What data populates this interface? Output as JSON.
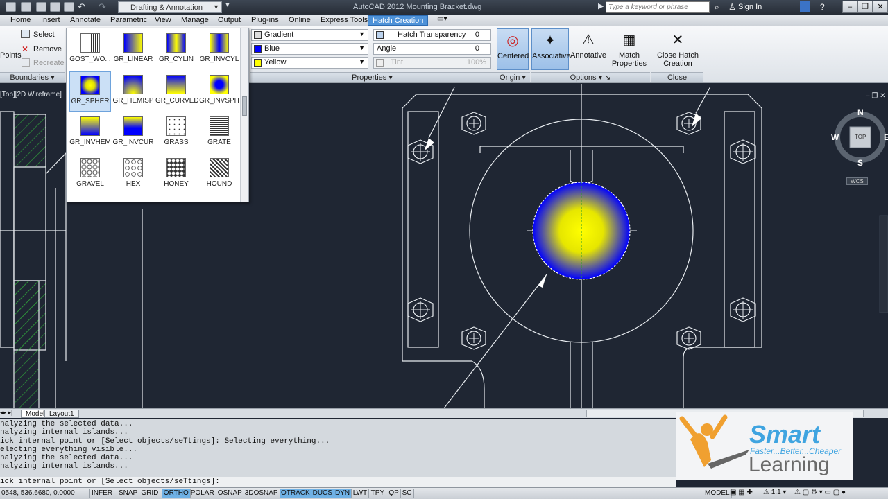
{
  "title_bar": {
    "workspace": "Drafting & Annotation",
    "app_title": "AutoCAD 2012    Mounting Bracket.dwg",
    "search_placeholder": "Type a keyword or phrase",
    "sign_in": "Sign In"
  },
  "tabs": [
    "Home",
    "Insert",
    "Annotate",
    "Parametric",
    "View",
    "Manage",
    "Output",
    "Plug-ins",
    "Online",
    "Express Tools",
    "Hatch Creation"
  ],
  "ribbon": {
    "boundaries": {
      "pick_points": "Points",
      "select": "Select",
      "remove": "Remove",
      "recreate": "Recreate",
      "footer": "Boundaries"
    },
    "properties": {
      "type": "Gradient",
      "color1": "Blue",
      "color2": "Yellow",
      "transparency_label": "Hatch Transparency",
      "transparency_value": "0",
      "angle_label": "Angle",
      "angle_value": "0",
      "tint_label": "Tint",
      "tint_value": "100%",
      "footer": "Properties"
    },
    "origin": {
      "centered": "Centered",
      "footer": "Origin"
    },
    "options": {
      "associative": "Associative",
      "annotative": "Annotative",
      "match_properties": "Match Properties",
      "footer": "Options"
    },
    "close": {
      "close_hatch": "Close Hatch Creation",
      "footer": "Close"
    }
  },
  "palette": [
    {
      "label": "GOST_WO..."
    },
    {
      "label": "GR_LINEAR"
    },
    {
      "label": "GR_CYLIN"
    },
    {
      "label": "GR_INVCYL"
    },
    {
      "label": "GR_SPHER"
    },
    {
      "label": "GR_HEMISP"
    },
    {
      "label": "GR_CURVED"
    },
    {
      "label": "GR_INVSPH"
    },
    {
      "label": "GR_INVHEM"
    },
    {
      "label": "GR_INVCUR"
    },
    {
      "label": "GRASS"
    },
    {
      "label": "GRATE"
    },
    {
      "label": "GRAVEL"
    },
    {
      "label": "HEX"
    },
    {
      "label": "HONEY"
    },
    {
      "label": "HOUND"
    }
  ],
  "viewport_label": "[Top][2D Wireframe]",
  "viewcube": {
    "n": "N",
    "s": "S",
    "e": "E",
    "w": "W",
    "face": "TOP",
    "wcs": "WCS"
  },
  "layout_tabs": [
    "Model",
    "Layout1"
  ],
  "command_history": [
    "nalyzing the selected data...",
    "nalyzing internal islands...",
    "ick internal point or [Select objects/seTtings]: Selecting everything...",
    "electing everything visible...",
    "nalyzing the selected data...",
    "nalyzing internal islands..."
  ],
  "command_line": "ick internal point or [Select objects/seTtings]:",
  "status": {
    "coords": "0548, 536.6680, 0.0000",
    "toggles": [
      "INFER",
      "SNAP",
      "GRID",
      "ORTHO",
      "POLAR",
      "OSNAP",
      "3DOSNAP",
      "OTRACK",
      "DUCS",
      "DYN",
      "LWT",
      "TPY",
      "QP",
      "SC"
    ],
    "on": [
      "ORTHO",
      "OTRACK",
      "DUCS",
      "DYN"
    ],
    "model": "MODEL",
    "scale": "1:1"
  },
  "logo": {
    "brand": "Smart",
    "tagline": "Faster...Better...Cheaper",
    "word": "Learning"
  },
  "colors": {
    "accent": "#4e92d8",
    "gradient_color1": "#0000ff",
    "gradient_color2": "#ffff00",
    "canvas": "#1f2633"
  }
}
